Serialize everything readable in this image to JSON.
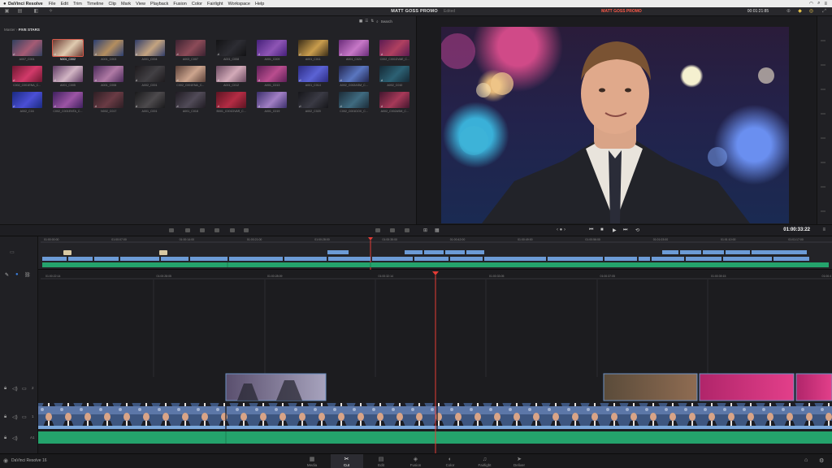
{
  "menubar": {
    "app": "DaVinci Resolve",
    "items": [
      "File",
      "Edit",
      "Trim",
      "Timeline",
      "Clip",
      "Mark",
      "View",
      "Playback",
      "Fusion",
      "Color",
      "Fairlight",
      "Workspace",
      "Help"
    ]
  },
  "toolbar": {
    "project_title": "MATT GOSS PROMO",
    "status": "Edited"
  },
  "media_pool": {
    "breadcrumb_root": "Master",
    "breadcrumb_current": "FIVE STARS",
    "search_label": "Search",
    "clips": [
      {
        "name": "A007_C001",
        "c1": "#31405f",
        "c2": "#a65b74"
      },
      {
        "name": "N001_C002",
        "c1": "#6b3a32",
        "c2": "#e0cbb0",
        "selected": true
      },
      {
        "name": "A001_C003",
        "c1": "#2a3e72",
        "c2": "#b48e5f"
      },
      {
        "name": "A001_C004",
        "c1": "#2f3c68",
        "c2": "#c4a480"
      },
      {
        "name": "A003_C007",
        "c1": "#3a2230",
        "c2": "#8c4b58"
      },
      {
        "name": "A001_C008",
        "c1": "#121214",
        "c2": "#2d2d33"
      },
      {
        "name": "A001_C009",
        "c1": "#45207a",
        "c2": "#8e55b5"
      },
      {
        "name": "A001_C011",
        "c1": "#3a2d18",
        "c2": "#c99d4d"
      },
      {
        "name": "A001_C021",
        "c1": "#6a2c7a",
        "c2": "#c778c7"
      },
      {
        "name": "C002_C001DVAE_C...",
        "c1": "#5b1b52",
        "c2": "#b04060"
      },
      {
        "name": "C002_C001ENA_C...",
        "c1": "#6d1730",
        "c2": "#d23a6a"
      },
      {
        "name": "A001_C005",
        "c1": "#5e3a63",
        "c2": "#d2b5c4"
      },
      {
        "name": "A001_C006",
        "c1": "#4a2a5a",
        "c2": "#b07aa5"
      },
      {
        "name": "A002_C001",
        "c1": "#1d1a1d",
        "c2": "#424044"
      },
      {
        "name": "C002_C001ENA_C...",
        "c1": "#5a4038",
        "c2": "#cda58e"
      },
      {
        "name": "A001_C012",
        "c1": "#6a4a60",
        "c2": "#d3aab8"
      },
      {
        "name": "A001_C013",
        "c1": "#5c1f56",
        "c2": "#b94d8e"
      },
      {
        "name": "A001_C014",
        "c1": "#2c2b82",
        "c2": "#5b63d4"
      },
      {
        "name": "A002_C002ASM_C...",
        "c1": "#22254e",
        "c2": "#5a76c0"
      },
      {
        "name": "A002_C010",
        "c1": "#152935",
        "c2": "#2c6174"
      },
      {
        "name": "A002_C16",
        "c1": "#1a2a80",
        "c2": "#4b4fd5"
      },
      {
        "name": "C002_C001ENTA_C...",
        "c1": "#3e1f5e",
        "c2": "#9c55a4"
      },
      {
        "name": "N002_C017",
        "c1": "#2d1e24",
        "c2": "#6a3b44"
      },
      {
        "name": "A001_C001",
        "c1": "#1a1a1c",
        "c2": "#4d4a4d"
      },
      {
        "name": "A001_C018",
        "c1": "#201c23",
        "c2": "#514b58"
      },
      {
        "name": "B001_C001DVAR_C...",
        "c1": "#5c1422",
        "c2": "#b42c44"
      },
      {
        "name": "A001_C019",
        "c1": "#3b2f6b",
        "c2": "#a17fc4"
      },
      {
        "name": "A002_C020",
        "c1": "#16161a",
        "c2": "#3a3a44"
      },
      {
        "name": "C002_C001DOX_C...",
        "c1": "#1c2c38",
        "c2": "#3f6b80"
      },
      {
        "name": "A002_C002ASM_C...",
        "c1": "#41162e",
        "c2": "#a73958"
      }
    ]
  },
  "viewer": {
    "title": "MATT GOSS PROMO",
    "timecode": "00:01:21:85",
    "transport_timecode": "01:00:33:22"
  },
  "upper_timeline": {
    "ruler": [
      "01:00:00:00",
      "01:00:07:00",
      "01:00:14:00",
      "01:00:21:00",
      "01:00:28:00",
      "01:00:35:00",
      "01:00:42:00",
      "01:00:49:00",
      "01:00:56:00",
      "01:01:03:00",
      "01:01:10:00",
      "01:01:17:00"
    ]
  },
  "lower_timeline": {
    "ruler": [
      "01:00:22:14",
      "01:00:28:05",
      "01:00:28:09",
      "01:00:32:14",
      "01:00:33:05",
      "01:00:37:05",
      "01:00:39:15",
      "01:00:4"
    ],
    "track_labels": [
      "2",
      "1",
      "A1"
    ]
  },
  "pages": [
    {
      "name": "Media",
      "icon": "▦"
    },
    {
      "name": "Cut",
      "icon": "✂",
      "active": true
    },
    {
      "name": "Edit",
      "icon": "▤"
    },
    {
      "name": "Fusion",
      "icon": "◈"
    },
    {
      "name": "Color",
      "icon": "◐"
    },
    {
      "name": "Fairlight",
      "icon": "♫"
    },
    {
      "name": "Deliver",
      "icon": "➤"
    }
  ],
  "app_version": "DaVinci Resolve 16",
  "colors": {
    "accent_red": "#e84a3a",
    "video_clip": "#6c9bd6",
    "audio_clip": "#24a36c",
    "playhead": "#e33b35"
  }
}
